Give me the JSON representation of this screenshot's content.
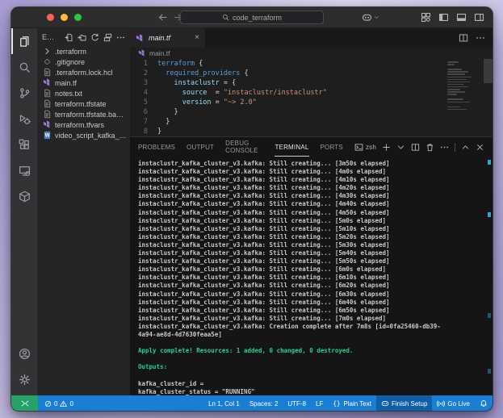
{
  "colors": {
    "status_blue": "#1a7fd4",
    "remote_green": "#26a269",
    "terminal_green": "#23d18b",
    "terraform_purple": "#9d78d2",
    "traffic_lights": [
      "#ff5f57",
      "#febc2e",
      "#28c840"
    ]
  },
  "titlebar": {
    "search_value": "code_terraform",
    "search_icon": "search",
    "actions": [
      {
        "id": "customize-layout",
        "icon": "layout-grid"
      },
      {
        "id": "toggle-primary-sidebar",
        "icon": "layout-left"
      },
      {
        "id": "toggle-panel",
        "icon": "layout-bottom"
      },
      {
        "id": "toggle-secondary-sidebar",
        "icon": "layout-right"
      }
    ]
  },
  "activity_bar": {
    "items": [
      {
        "id": "explorer",
        "icon": "files",
        "active": true
      },
      {
        "id": "search",
        "icon": "search"
      },
      {
        "id": "source-control",
        "icon": "scm"
      },
      {
        "id": "run-debug",
        "icon": "debug"
      },
      {
        "id": "extensions",
        "icon": "extensions"
      },
      {
        "id": "remote-explorer",
        "icon": "monitor"
      },
      {
        "id": "cube-extension",
        "icon": "cube"
      }
    ],
    "bottom": [
      {
        "id": "accounts",
        "icon": "account"
      },
      {
        "id": "settings",
        "icon": "gear"
      }
    ]
  },
  "sidebar": {
    "title": "E…",
    "actions": [
      {
        "id": "new-file",
        "icon": "new-file"
      },
      {
        "id": "new-folder",
        "icon": "new-folder"
      },
      {
        "id": "refresh-explorer",
        "icon": "refresh"
      },
      {
        "id": "collapse-folders",
        "icon": "collapse-all"
      },
      {
        "id": "more-actions",
        "icon": "more"
      }
    ],
    "files": [
      {
        "name": ".terraform",
        "icon": "chevron-right",
        "kind": "folder"
      },
      {
        "name": ".gitignore",
        "icon": "gitignore",
        "kind": "file"
      },
      {
        "name": ".terraform.lock.hcl",
        "icon": "file",
        "kind": "file"
      },
      {
        "name": "main.tf",
        "icon": "terraform",
        "kind": "file"
      },
      {
        "name": "notes.txt",
        "icon": "file",
        "kind": "file"
      },
      {
        "name": "terraform.tfstate",
        "icon": "file",
        "kind": "file"
      },
      {
        "name": "terraform.tfstate.ba…",
        "icon": "file",
        "kind": "file"
      },
      {
        "name": "terraform.tfvars",
        "icon": "terraform",
        "kind": "file"
      },
      {
        "name": "video_script_kafka_…",
        "icon": "word-doc",
        "kind": "file"
      }
    ]
  },
  "editor": {
    "tab": {
      "label": "main.tf",
      "icon": "terraform"
    },
    "tab_actions": [
      {
        "id": "split-editor",
        "icon": "split"
      },
      {
        "id": "more-actions",
        "icon": "more"
      }
    ],
    "breadcrumb": "main.tf",
    "code_lines": [
      {
        "num": "1",
        "segments": [
          {
            "t": "terraform",
            "c": "kw"
          },
          {
            "t": " {",
            "c": "p"
          }
        ]
      },
      {
        "num": "2",
        "segments": [
          {
            "t": "  ",
            "c": "p"
          },
          {
            "t": "required_providers",
            "c": "kw"
          },
          {
            "t": " {",
            "c": "p"
          }
        ]
      },
      {
        "num": "3",
        "segments": [
          {
            "t": "    ",
            "c": "p"
          },
          {
            "t": "instaclustr",
            "c": "var"
          },
          {
            "t": " = {",
            "c": "p"
          }
        ]
      },
      {
        "num": "4",
        "segments": [
          {
            "t": "      ",
            "c": "p"
          },
          {
            "t": "source",
            "c": "var"
          },
          {
            "t": "  = ",
            "c": "p"
          },
          {
            "t": "\"instaclustr/instaclustr\"",
            "c": "str"
          }
        ]
      },
      {
        "num": "5",
        "segments": [
          {
            "t": "      ",
            "c": "p"
          },
          {
            "t": "version",
            "c": "var"
          },
          {
            "t": " = ",
            "c": "p"
          },
          {
            "t": "\"~> 2.0\"",
            "c": "str"
          }
        ]
      },
      {
        "num": "6",
        "segments": [
          {
            "t": "    }",
            "c": "p"
          }
        ]
      },
      {
        "num": "7",
        "segments": [
          {
            "t": "  }",
            "c": "p"
          }
        ]
      },
      {
        "num": "8",
        "segments": [
          {
            "t": "}",
            "c": "p"
          }
        ]
      }
    ]
  },
  "panel": {
    "tabs": [
      {
        "label": "PROBLEMS",
        "active": false
      },
      {
        "label": "OUTPUT",
        "active": false
      },
      {
        "label": "DEBUG CONSOLE",
        "active": false
      },
      {
        "label": "TERMINAL",
        "active": true
      },
      {
        "label": "PORTS",
        "active": false
      }
    ],
    "actions": [
      {
        "id": "terminal-profile",
        "icon": "terminal",
        "label": "zsh"
      },
      {
        "id": "new-terminal",
        "icon": "plus"
      },
      {
        "id": "launch-profile-dropdown",
        "icon": "chev-down"
      },
      {
        "id": "split-terminal",
        "icon": "split"
      },
      {
        "id": "kill-terminal",
        "icon": "trash"
      },
      {
        "id": "more-actions",
        "icon": "more"
      },
      {
        "id": "divider"
      },
      {
        "id": "maximize-panel",
        "icon": "chev-up"
      },
      {
        "id": "close-panel",
        "icon": "close-x"
      }
    ],
    "terminal_lines": [
      {
        "text": "instaclustr_kafka_cluster_v3.kafka: Still creating... [3m50s elapsed]",
        "style": ""
      },
      {
        "text": "instaclustr_kafka_cluster_v3.kafka: Still creating... [4m0s elapsed]",
        "style": ""
      },
      {
        "text": "instaclustr_kafka_cluster_v3.kafka: Still creating... [4m10s elapsed]",
        "style": ""
      },
      {
        "text": "instaclustr_kafka_cluster_v3.kafka: Still creating... [4m20s elapsed]",
        "style": ""
      },
      {
        "text": "instaclustr_kafka_cluster_v3.kafka: Still creating... [4m30s elapsed]",
        "style": ""
      },
      {
        "text": "instaclustr_kafka_cluster_v3.kafka: Still creating... [4m40s elapsed]",
        "style": ""
      },
      {
        "text": "instaclustr_kafka_cluster_v3.kafka: Still creating... [4m50s elapsed]",
        "style": ""
      },
      {
        "text": "instaclustr_kafka_cluster_v3.kafka: Still creating... [5m0s elapsed]",
        "style": ""
      },
      {
        "text": "instaclustr_kafka_cluster_v3.kafka: Still creating... [5m10s elapsed]",
        "style": ""
      },
      {
        "text": "instaclustr_kafka_cluster_v3.kafka: Still creating... [5m20s elapsed]",
        "style": ""
      },
      {
        "text": "instaclustr_kafka_cluster_v3.kafka: Still creating... [5m30s elapsed]",
        "style": ""
      },
      {
        "text": "instaclustr_kafka_cluster_v3.kafka: Still creating... [5m40s elapsed]",
        "style": ""
      },
      {
        "text": "instaclustr_kafka_cluster_v3.kafka: Still creating... [5m50s elapsed]",
        "style": ""
      },
      {
        "text": "instaclustr_kafka_cluster_v3.kafka: Still creating... [6m0s elapsed]",
        "style": ""
      },
      {
        "text": "instaclustr_kafka_cluster_v3.kafka: Still creating... [6m10s elapsed]",
        "style": ""
      },
      {
        "text": "instaclustr_kafka_cluster_v3.kafka: Still creating... [6m20s elapsed]",
        "style": ""
      },
      {
        "text": "instaclustr_kafka_cluster_v3.kafka: Still creating... [6m30s elapsed]",
        "style": ""
      },
      {
        "text": "instaclustr_kafka_cluster_v3.kafka: Still creating... [6m40s elapsed]",
        "style": ""
      },
      {
        "text": "instaclustr_kafka_cluster_v3.kafka: Still creating... [6m50s elapsed]",
        "style": ""
      },
      {
        "text": "instaclustr_kafka_cluster_v3.kafka: Still creating... [7m0s elapsed]",
        "style": ""
      },
      {
        "text": "instaclustr_kafka_cluster_v3.kafka: Creation complete after 7m8s [id=0fa25460-db39-",
        "style": ""
      },
      {
        "text": "4a94-ae8d-4d7630feaa5e]",
        "style": ""
      },
      {
        "text": "",
        "style": ""
      },
      {
        "text": "Apply complete! Resources: 1 added, 0 changed, 0 destroyed.",
        "style": "green"
      },
      {
        "text": "",
        "style": ""
      },
      {
        "text": "Outputs:",
        "style": "green"
      },
      {
        "text": "",
        "style": ""
      },
      {
        "text": "kafka_cluster_id =",
        "style": ""
      },
      {
        "text": "kafka_cluster_status = \"RUNNING\"",
        "style": ""
      }
    ]
  },
  "status_bar": {
    "errors": "0",
    "warnings": "0",
    "items_right": [
      {
        "id": "cursor-position",
        "label": "Ln 1, Col 1"
      },
      {
        "id": "indentation",
        "label": "Spaces: 2"
      },
      {
        "id": "encoding",
        "label": "UTF-8"
      },
      {
        "id": "eol",
        "label": "LF"
      },
      {
        "id": "language-mode",
        "label": "Plain Text",
        "icon": "braces"
      },
      {
        "id": "finish-setup",
        "label": "Finish Setup",
        "icon": "copilot",
        "emphasis": true
      },
      {
        "id": "go-live",
        "label": "Go Live",
        "icon": "broadcast"
      },
      {
        "id": "notifications",
        "label": "",
        "icon": "bell"
      }
    ]
  }
}
